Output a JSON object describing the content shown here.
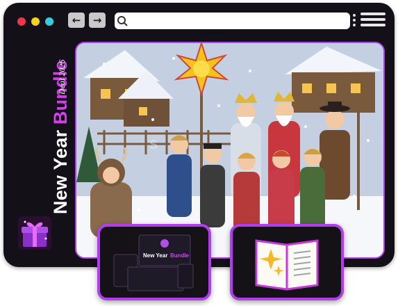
{
  "window": {
    "traffic_lights": [
      {
        "name": "close",
        "color": "#f0344c"
      },
      {
        "name": "minimize",
        "color": "#f7d21c"
      },
      {
        "name": "maximize",
        "color": "#34cde0"
      }
    ],
    "back_icon": "←",
    "forward_icon": "→",
    "search_icon": "magnifier",
    "address_value": "",
    "menu_icon": "hamburger",
    "more_icon": "kebab"
  },
  "sidebar": {
    "title_part1": "New Year ",
    "title_part2": "Bundle",
    "subtitle": "Deal 2026",
    "accent_color": "#d43cf0",
    "logo_icon": "gift-box"
  },
  "main": {
    "image_subject": "winter-caroling-illustration",
    "watermark": "S"
  },
  "thumbnails": {
    "product_bundle": {
      "icon": "device-mockups",
      "mini_title_part1": "New Year ",
      "mini_title_part2": "Bundle"
    },
    "book": {
      "icon": "open-book-with-sparkles"
    }
  },
  "colors": {
    "frame": "#131017",
    "accent": "#b43cf0",
    "sky": "#c8d3e4",
    "snow": "#f5f7fb"
  }
}
